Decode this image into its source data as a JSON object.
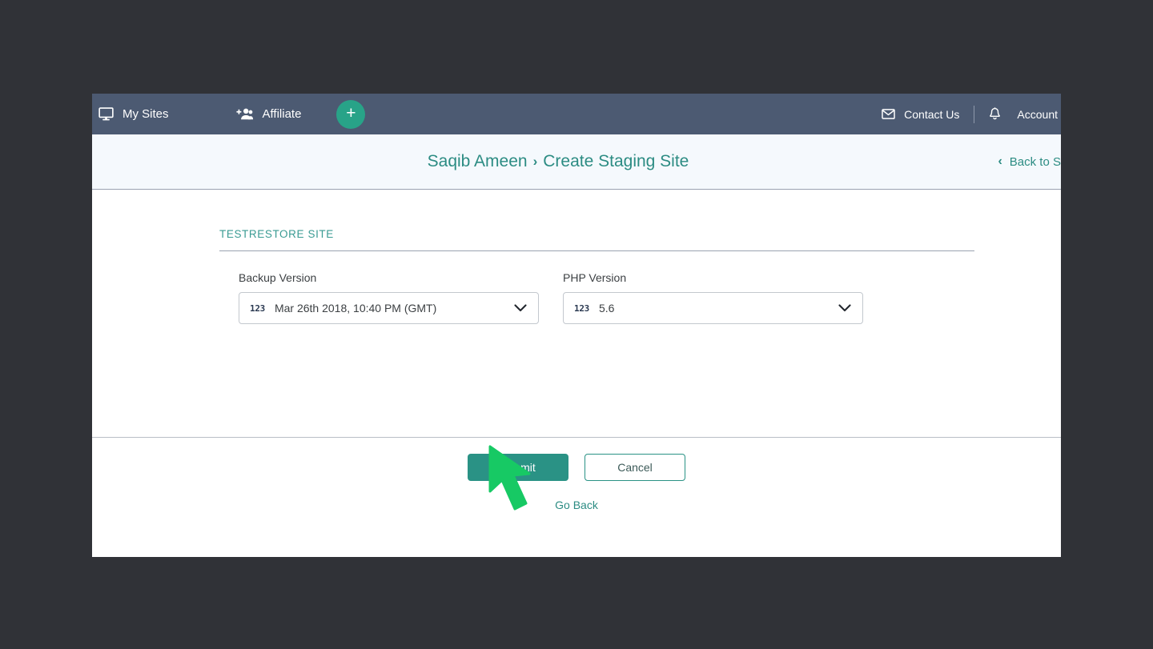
{
  "topbar": {
    "my_sites": {
      "label": "My Sites",
      "icon": "monitor-icon"
    },
    "affiliate": {
      "label": "Affiliate",
      "icon": "add-users-icon"
    },
    "add_button": {
      "label": "+",
      "icon": "plus-icon"
    },
    "contact_us": {
      "label": "Contact Us",
      "icon": "envelope-icon"
    },
    "notifications": {
      "icon": "bell-icon"
    },
    "account": {
      "label": "Account"
    },
    "bg_color": "#4c5a72",
    "accent_color": "#28a388"
  },
  "breadcrumb": {
    "site_name": "Saqib Ameen",
    "separator": "›",
    "page": "Create Staging Site",
    "back_link": {
      "label": "Back to S",
      "chevron": "‹"
    },
    "color": "#2c8c83"
  },
  "tabs": [
    {
      "label": "TESTRESTORE SITE",
      "active": true
    }
  ],
  "form": {
    "fields": [
      {
        "label": "Backup Version",
        "value": "Mar 26th 2018, 10:40 PM (GMT)",
        "icon": "numeric-123-icon",
        "chevron": "chevron-down-icon"
      },
      {
        "label": "PHP Version",
        "value": "5.6",
        "icon": "numeric-123-icon",
        "chevron": "chevron-down-icon"
      }
    ]
  },
  "footer": {
    "submit_label": "Submit",
    "cancel_label": "Cancel",
    "go_back_label": "Go Back",
    "submit_color": "#2a9285"
  },
  "cursor": {
    "color": "#17c964",
    "name": "mouse-pointer"
  }
}
